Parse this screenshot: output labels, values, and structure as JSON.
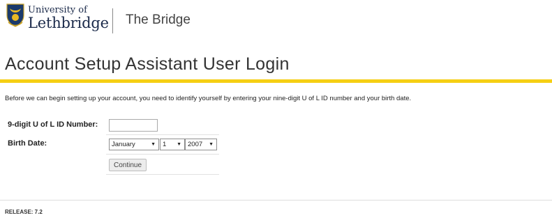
{
  "header": {
    "logo_line1": "University of",
    "logo_line2": "Lethbridge",
    "site_title": "The Bridge"
  },
  "page": {
    "title": "Account Setup Assistant User Login",
    "intro": "Before we can begin setting up your account, you need to identify yourself by entering your nine-digit U of L ID number and your birth date."
  },
  "form": {
    "id_label": "9-digit U of L ID Number:",
    "id_value": "",
    "birth_label": "Birth Date:",
    "month": "January",
    "day": "1",
    "year": "2007",
    "continue_label": "Continue"
  },
  "footer": {
    "release": "RELEASE: 7.2"
  },
  "colors": {
    "accent_yellow": "#f5cf14",
    "shield_navy": "#1b3a6b",
    "shield_gold": "#e8b923"
  }
}
